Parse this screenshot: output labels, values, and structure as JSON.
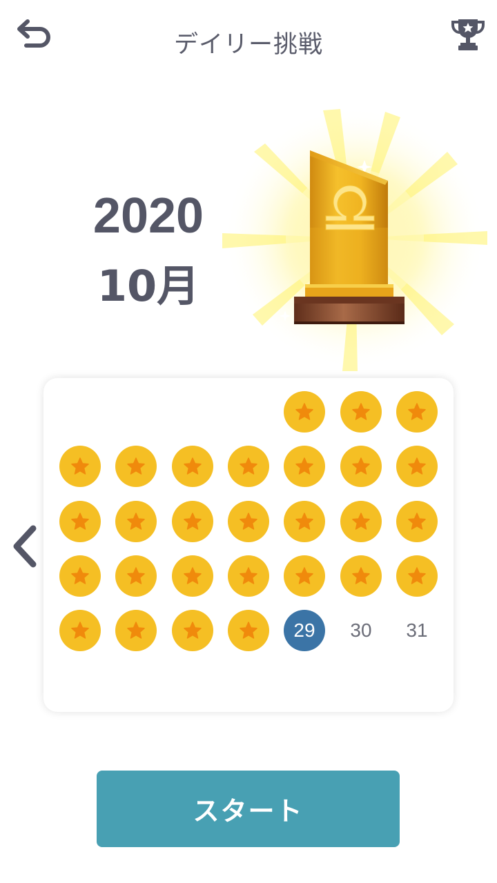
{
  "header": {
    "title": "デイリー挑戦",
    "back_icon": "back-arrow-icon",
    "trophy_icon": "trophy-icon"
  },
  "date": {
    "year": "2020",
    "month": "10月"
  },
  "calendar": {
    "completed_days": [
      1,
      2,
      3,
      4,
      5,
      6,
      7,
      8,
      9,
      10,
      11,
      12,
      13,
      14,
      15,
      16,
      17,
      18,
      19,
      20,
      21,
      22,
      23,
      24,
      25,
      26,
      27,
      28
    ],
    "today_label": "29",
    "future_labels": [
      "30",
      "31"
    ],
    "completed_icon": "star-icon",
    "prev_icon": "chevron-left-icon"
  },
  "start_button": {
    "label": "スタート"
  },
  "colors": {
    "coin": "#f5bf24",
    "star": "#f08a0c",
    "today": "#3b74a6",
    "start_button": "#48a0b3",
    "text": "#545666"
  }
}
